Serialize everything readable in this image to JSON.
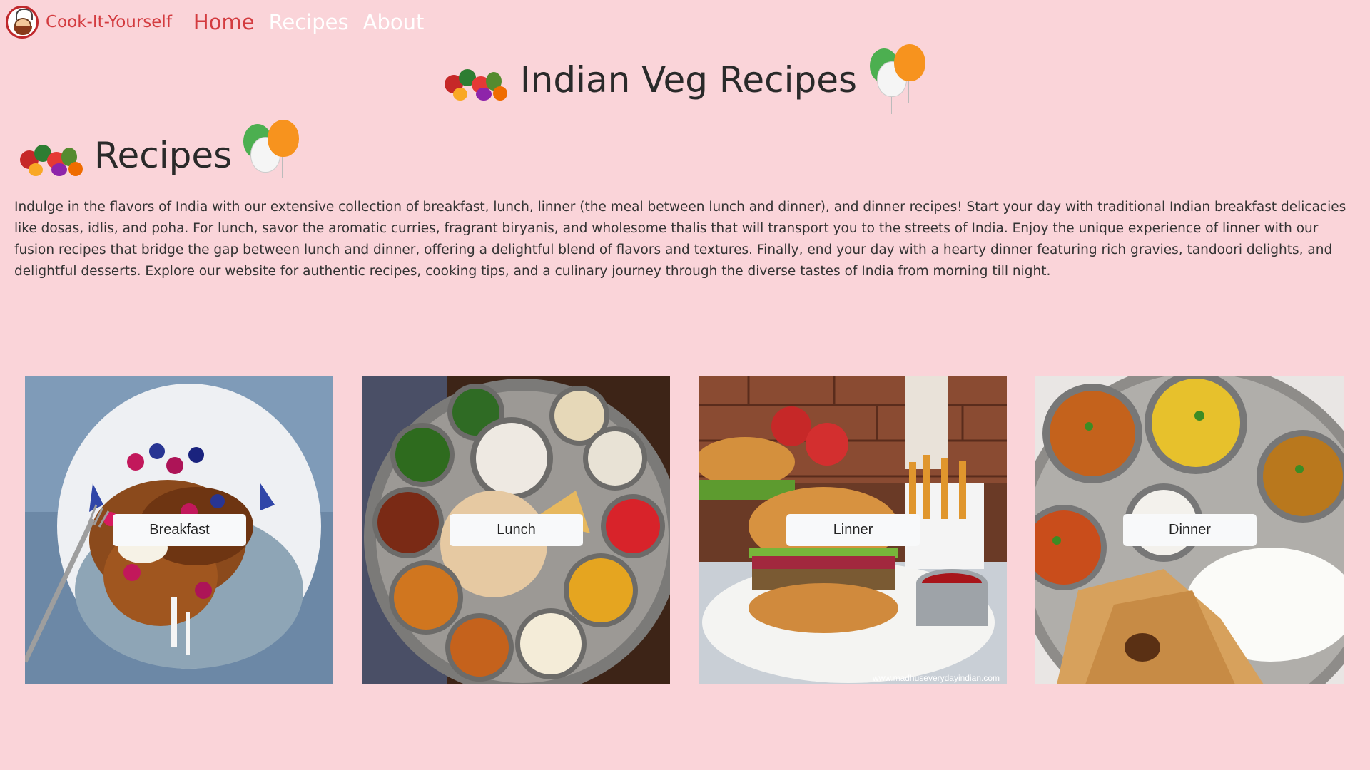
{
  "navbar": {
    "brand_name": "Cook-It-Yourself",
    "links": [
      {
        "label": "Home",
        "active": true
      },
      {
        "label": "Recipes",
        "active": false
      },
      {
        "label": "About",
        "active": false
      }
    ]
  },
  "hero": {
    "title": "Indian Veg Recipes"
  },
  "section": {
    "title": "Recipes",
    "intro": "Indulge in the flavors of India with our extensive collection of breakfast, lunch, linner (the meal between lunch and dinner), and dinner recipes! Start your day with traditional Indian breakfast delicacies like dosas, idlis, and poha. For lunch, savor the aromatic curries, fragrant biryanis, and wholesome thalis that will transport you to the streets of India. Enjoy the unique experience of linner with our fusion recipes that bridge the gap between lunch and dinner, offering a delightful blend of flavors and textures. Finally, end your day with a hearty dinner featuring rich gravies, tandoori delights, and delightful desserts. Explore our website for authentic recipes, cooking tips, and a culinary journey through the diverse tastes of India from morning till night."
  },
  "cards": [
    {
      "label": "Breakfast",
      "image": "french-toast-plate"
    },
    {
      "label": "Lunch",
      "image": "indian-thali"
    },
    {
      "label": "Linner",
      "image": "veggie-burger-fries",
      "watermark": "www.madhuseverydayindian.com"
    },
    {
      "label": "Dinner",
      "image": "dal-rice-roti-thali"
    }
  ],
  "colors": {
    "background": "#fad4d9",
    "brand": "#d33b3f",
    "nav_inactive": "#ffffff"
  }
}
